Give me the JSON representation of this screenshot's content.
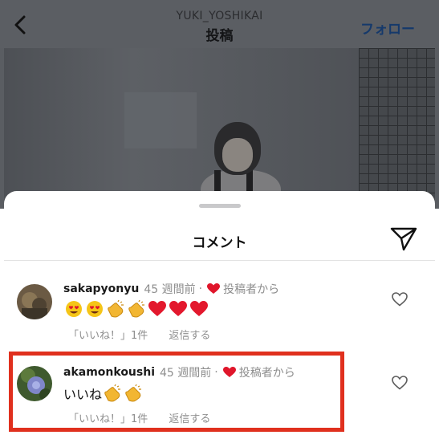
{
  "post_header": {
    "username": "YUKI_YOSHIKAI",
    "title": "投稿",
    "follow_label": "フォロー"
  },
  "comments_sheet": {
    "title": "コメント"
  },
  "comments": [
    {
      "username": "sakapyonyu",
      "time": "45 週間前",
      "separator": "·",
      "liked_by_author": "投稿者から",
      "text": "",
      "emojis": [
        "heart-eyes",
        "heart-eyes",
        "clap",
        "clap",
        "heart",
        "heart",
        "heart"
      ],
      "likes_label": "「いいね！」1件",
      "reply_label": "返信する"
    },
    {
      "username": "akamonkoushi",
      "time": "45 週間前",
      "separator": "·",
      "liked_by_author": "投稿者から",
      "text": "いいね",
      "emojis": [
        "clap",
        "clap"
      ],
      "likes_label": "「いいね！」1件",
      "reply_label": "返信する"
    }
  ],
  "colors": {
    "accent_heart": "#e0162b",
    "highlight": "#e0301e",
    "follow": "#15396b"
  }
}
